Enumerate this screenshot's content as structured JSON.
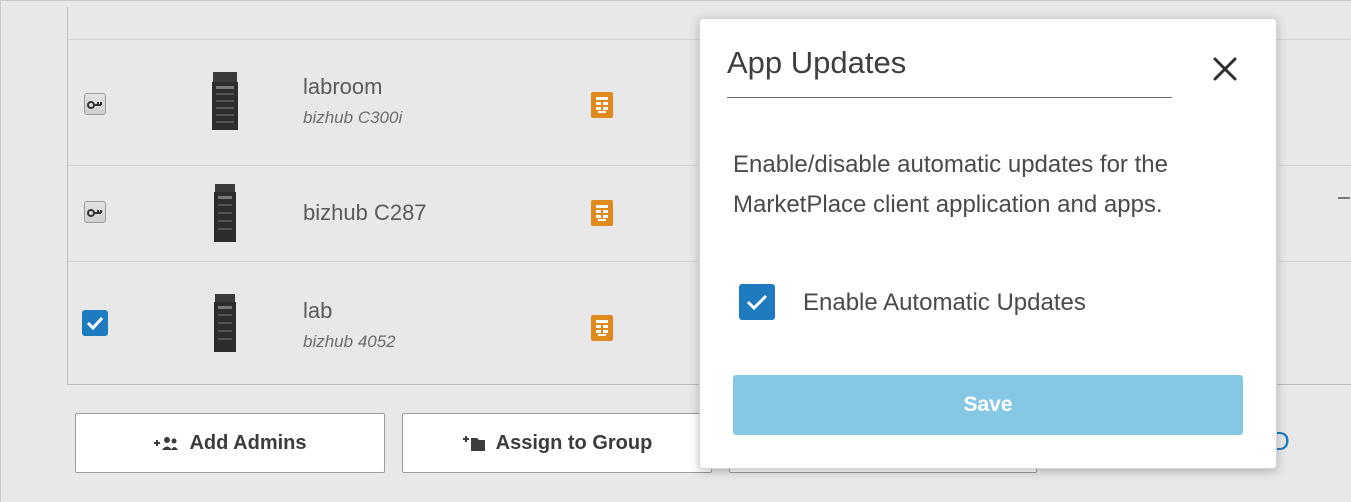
{
  "devices": [
    {
      "name": "labroom",
      "model": "bizhub C300i",
      "checkbox": "key",
      "selected": false
    },
    {
      "name": "bizhub C287",
      "model": "",
      "checkbox": "key",
      "selected": false
    },
    {
      "name": "lab",
      "model": "bizhub 4052",
      "checkbox": "checked",
      "selected": true
    }
  ],
  "icons": {
    "key_checkbox": "key-icon",
    "printer": "printer-icon",
    "status": "device-status-icon",
    "add_admins": "add-users-icon",
    "assign_group": "add-folder-icon",
    "close": "close-icon",
    "check": "check-icon"
  },
  "colors": {
    "accent_blue": "#1f7bbf",
    "save_disabled": "#85c8e4",
    "status_orange": "#e08a1e"
  },
  "actions": {
    "add_admins_label": "Add Admins",
    "assign_group_label": "Assign to Group",
    "trailing_char": "D"
  },
  "modal": {
    "title": "App Updates",
    "description": "Enable/disable automatic updates for the MarketPlace client application and apps.",
    "checkbox_label": "Enable Automatic Updates",
    "checkbox_checked": true,
    "save_label": "Save"
  }
}
